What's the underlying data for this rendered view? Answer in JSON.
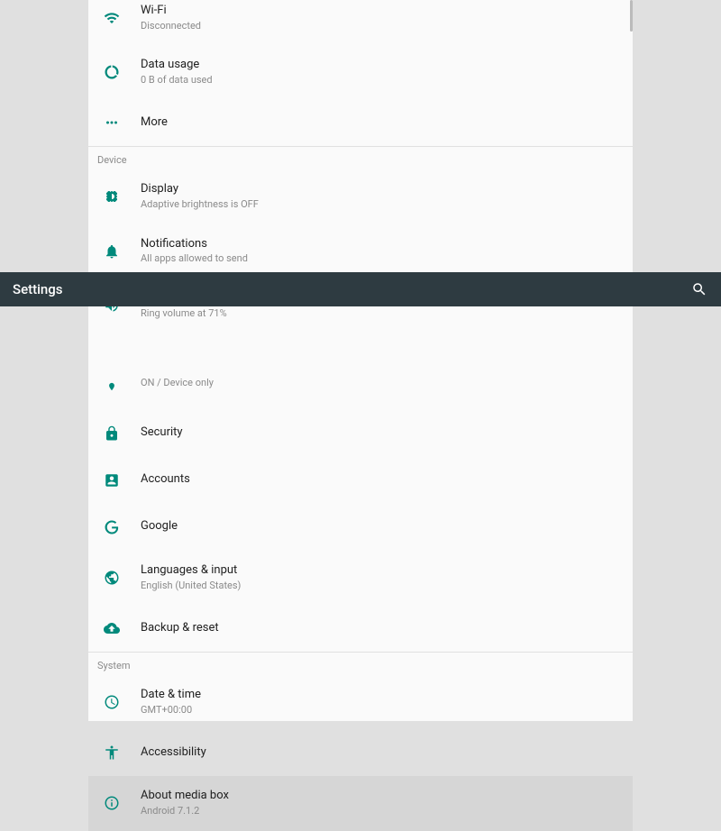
{
  "appbar": {
    "title": "Settings"
  },
  "colors": {
    "accent": "#00897b"
  },
  "sections": {
    "wireless": {
      "wifi": {
        "title": "Wi-Fi",
        "subtitle": "Disconnected"
      },
      "data_usage": {
        "title": "Data usage",
        "subtitle": "0 B of data used"
      },
      "more": {
        "title": "More"
      }
    },
    "device_header": "Device",
    "device": {
      "display": {
        "title": "Display",
        "subtitle": "Adaptive brightness is OFF"
      },
      "notifications": {
        "title": "Notifications",
        "subtitle": "All apps allowed to send"
      },
      "sound": {
        "title": "Sound",
        "subtitle": "Ring volume at 71%"
      },
      "location_partial": {
        "subtitle": "ON / Device only"
      }
    },
    "personal": {
      "security": {
        "title": "Security"
      },
      "accounts": {
        "title": "Accounts"
      },
      "google": {
        "title": "Google"
      },
      "languages": {
        "title": "Languages & input",
        "subtitle": "English (United States)"
      },
      "backup": {
        "title": "Backup & reset"
      }
    },
    "system_header": "System",
    "system": {
      "date_time": {
        "title": "Date & time",
        "subtitle": "GMT+00:00"
      },
      "accessibility": {
        "title": "Accessibility"
      },
      "about": {
        "title": "About media box",
        "subtitle": "Android 7.1.2"
      }
    }
  }
}
